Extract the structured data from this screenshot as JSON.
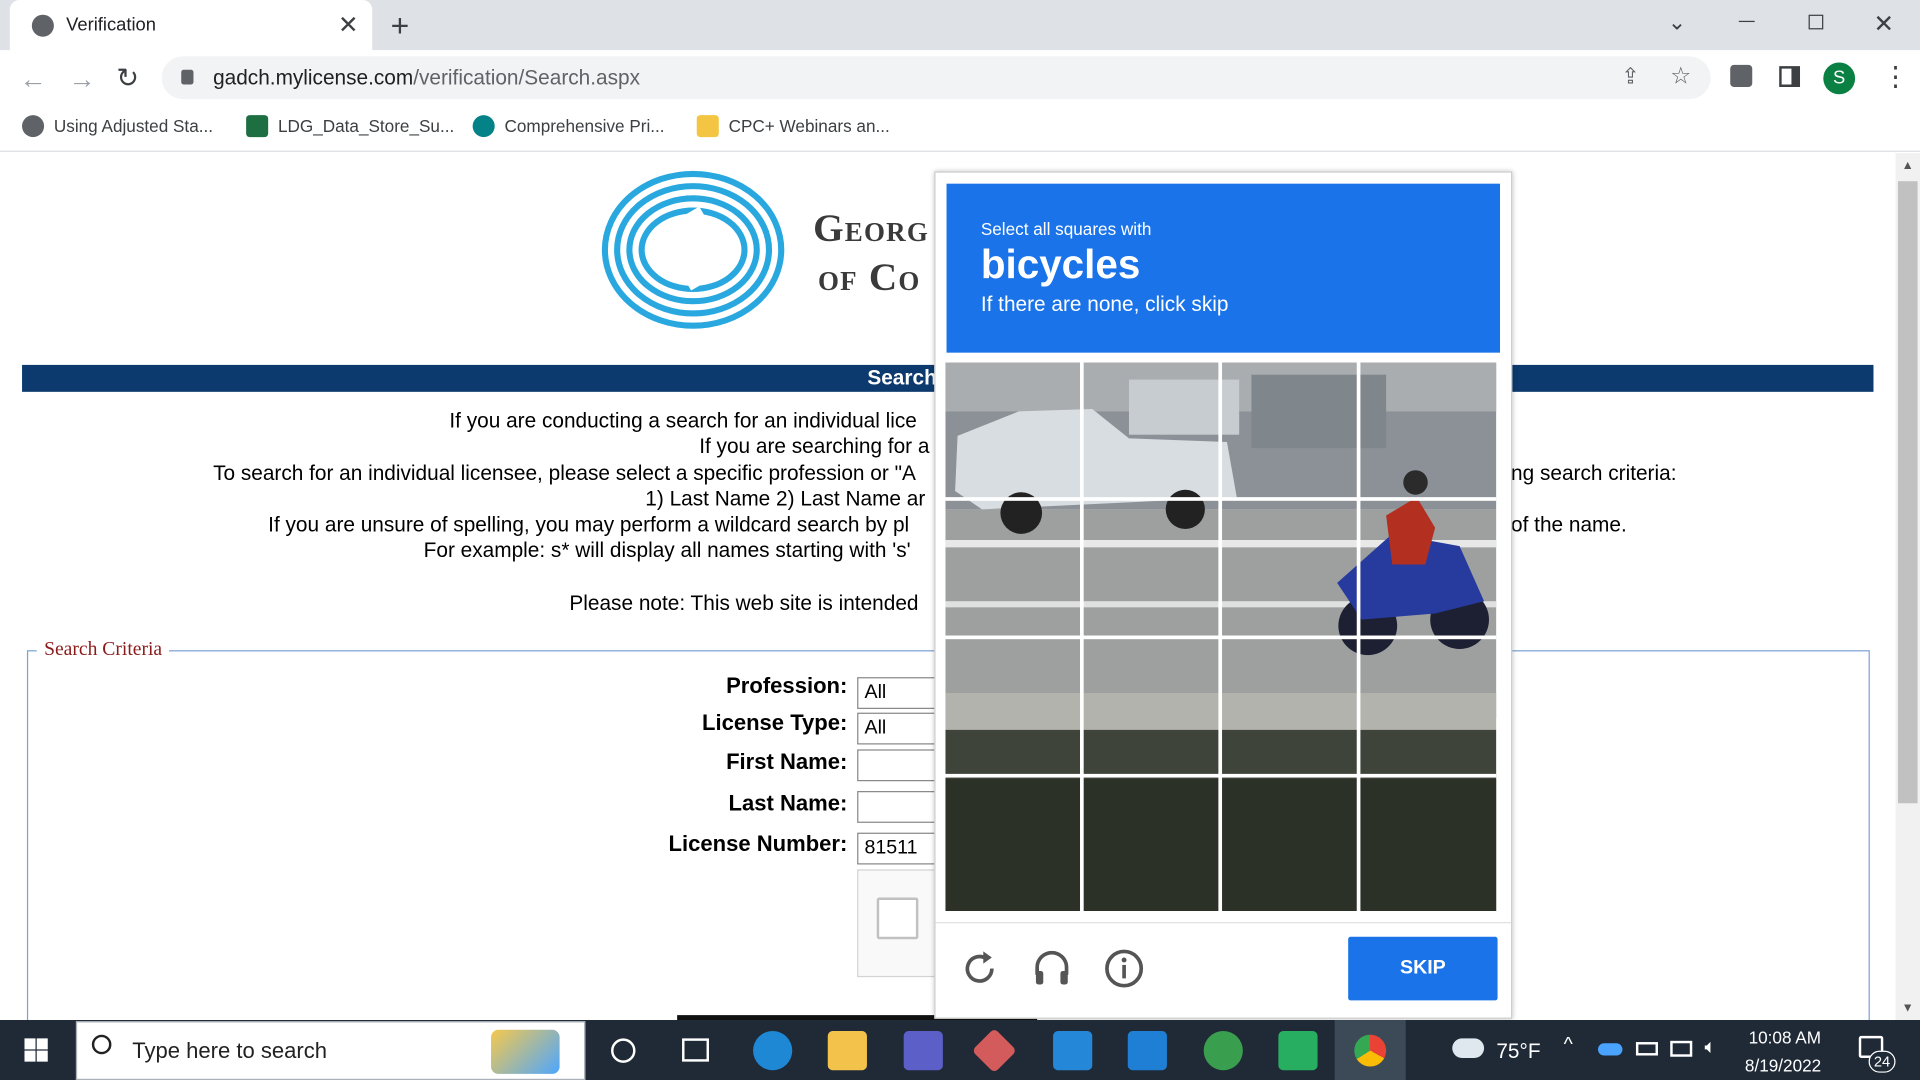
{
  "browser": {
    "tab_title": "Verification",
    "url_domain": "gadch.mylicense.com",
    "url_path": "/verification/Search.aspx",
    "profile_initial": "S",
    "bookmarks": [
      {
        "label": "Using Adjusted Sta...",
        "icon": "globe-icon",
        "color": "#5f6368"
      },
      {
        "label": "LDG_Data_Store_Su...",
        "icon": "excel-icon",
        "color": "#1d6f42"
      },
      {
        "label": "Comprehensive Pri...",
        "icon": "sharepoint-icon",
        "color": "#038387"
      },
      {
        "label": "CPC+ Webinars an...",
        "icon": "folder-icon",
        "color": "#f4c542"
      }
    ]
  },
  "page": {
    "logo_line1": "Georg",
    "logo_line2": "of Co",
    "banner": "Search for a Pro",
    "intro_lines": [
      "If you are conducting a search for an individual lice",
      "If you are searching for a",
      "To search for an individual licensee, please select a specific profession or \"A",
      "1) Last Name 2) Last Name ar",
      "If you are unsure of spelling, you may perform a wildcard search by pl",
      "For example: s* will display all names starting with 's'",
      "Please note: This web site is intended"
    ],
    "intro_right_lines": [
      "ng search criteria:",
      "of the name."
    ],
    "fieldset_legend": "Search Criteria",
    "fields": [
      {
        "label": "Profession:",
        "value": "All"
      },
      {
        "label": "License Type:",
        "value": "All"
      },
      {
        "label": "First Name:",
        "value": ""
      },
      {
        "label": "Last Name:",
        "value": ""
      },
      {
        "label": "License Number:",
        "value": "81511"
      }
    ]
  },
  "captcha": {
    "instruction": "Select all squares with",
    "target": "bicycles",
    "hint": "If there are none, click skip",
    "skip_label": "SKIP",
    "icons": [
      "reload-icon",
      "audio-icon",
      "info-icon"
    ]
  },
  "taskbar": {
    "search_placeholder": "Type here to search",
    "weather": "75°F",
    "time": "10:08 AM",
    "date": "8/19/2022",
    "notifications": "24"
  }
}
